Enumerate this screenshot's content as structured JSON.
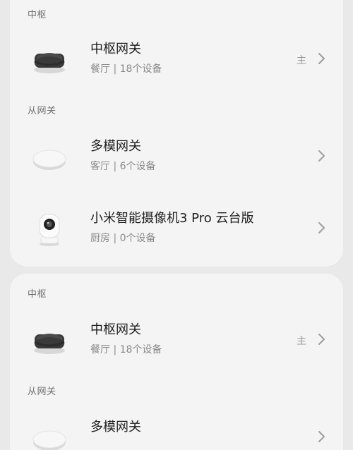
{
  "sections": {
    "hub_label": "中枢",
    "sub_label": "从网关"
  },
  "top": {
    "hub": {
      "name": "中枢网关",
      "meta": "餐厅 | 18个设备",
      "tag": "主",
      "icon": "hub-gateway-icon"
    },
    "subs": [
      {
        "name": "多模网关",
        "meta": "客厅 | 6个设备",
        "icon": "multimode-gateway-icon"
      },
      {
        "name": "小米智能摄像机3 Pro 云台版",
        "meta": "厨房 | 0个设备",
        "icon": "camera-icon"
      }
    ]
  },
  "bottom": {
    "hub": {
      "name": "中枢网关",
      "meta": "餐厅 | 18个设备",
      "tag": "主",
      "icon": "hub-gateway-icon"
    },
    "subs": [
      {
        "name": "多模网关",
        "icon": "multimode-gateway-icon"
      }
    ]
  },
  "colors": {
    "background": "#e9e9e9",
    "panel": "#f4f4f4",
    "primary_text": "#1f1f1f",
    "secondary_text": "#8a8a8a"
  }
}
